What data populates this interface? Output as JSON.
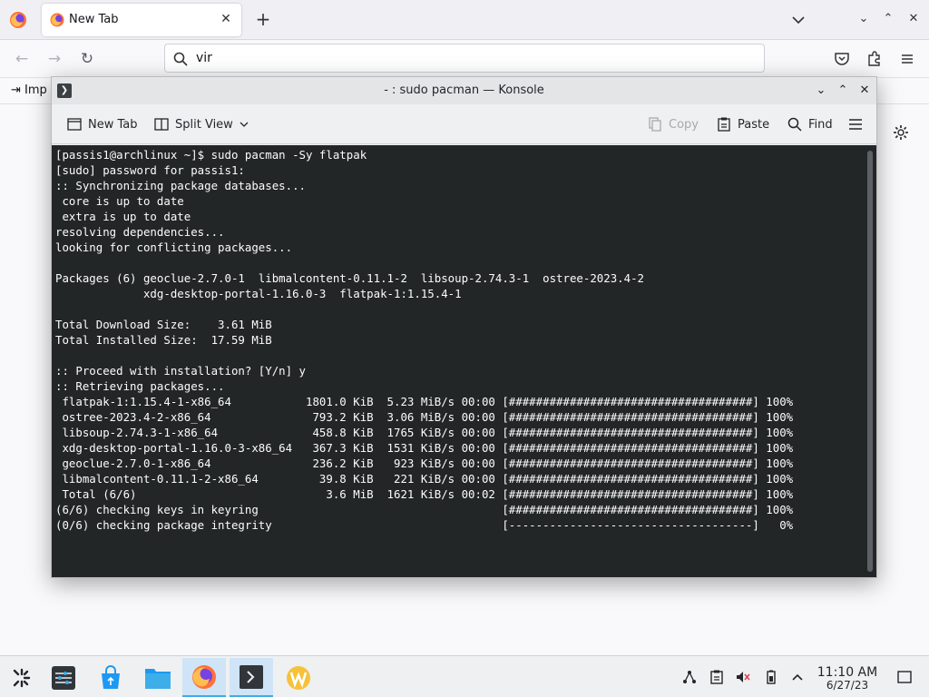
{
  "firefox": {
    "tab": {
      "title": "New Tab"
    },
    "urlbar": {
      "value": "vir"
    },
    "bookmarks": {
      "import_label": "Imp"
    }
  },
  "konsole": {
    "title": "- : sudo pacman — Konsole",
    "toolbar": {
      "new_tab": "New Tab",
      "split_view": "Split View",
      "copy": "Copy",
      "paste": "Paste",
      "find": "Find"
    },
    "terminal": [
      "[passis1@archlinux ~]$ sudo pacman -Sy flatpak",
      "[sudo] password for passis1:",
      ":: Synchronizing package databases...",
      " core is up to date",
      " extra is up to date",
      "resolving dependencies...",
      "looking for conflicting packages...",
      "",
      "Packages (6) geoclue-2.7.0-1  libmalcontent-0.11.1-2  libsoup-2.74.3-1  ostree-2023.4-2",
      "             xdg-desktop-portal-1.16.0-3  flatpak-1:1.15.4-1",
      "",
      "Total Download Size:    3.61 MiB",
      "Total Installed Size:  17.59 MiB",
      "",
      ":: Proceed with installation? [Y/n] y",
      ":: Retrieving packages...",
      " flatpak-1:1.15.4-1-x86_64           1801.0 KiB  5.23 MiB/s 00:00 [####################################] 100%",
      " ostree-2023.4-2-x86_64               793.2 KiB  3.06 MiB/s 00:00 [####################################] 100%",
      " libsoup-2.74.3-1-x86_64              458.8 KiB  1765 KiB/s 00:00 [####################################] 100%",
      " xdg-desktop-portal-1.16.0-3-x86_64   367.3 KiB  1531 KiB/s 00:00 [####################################] 100%",
      " geoclue-2.7.0-1-x86_64               236.2 KiB   923 KiB/s 00:00 [####################################] 100%",
      " libmalcontent-0.11.1-2-x86_64         39.8 KiB   221 KiB/s 00:00 [####################################] 100%",
      " Total (6/6)                            3.6 MiB  1621 KiB/s 00:02 [####################################] 100%",
      "(6/6) checking keys in keyring                                    [####################################] 100%",
      "(0/6) checking package integrity                                  [------------------------------------]   0%"
    ]
  },
  "taskbar": {
    "clock": {
      "time": "11:10 AM",
      "date": "6/27/23"
    }
  }
}
